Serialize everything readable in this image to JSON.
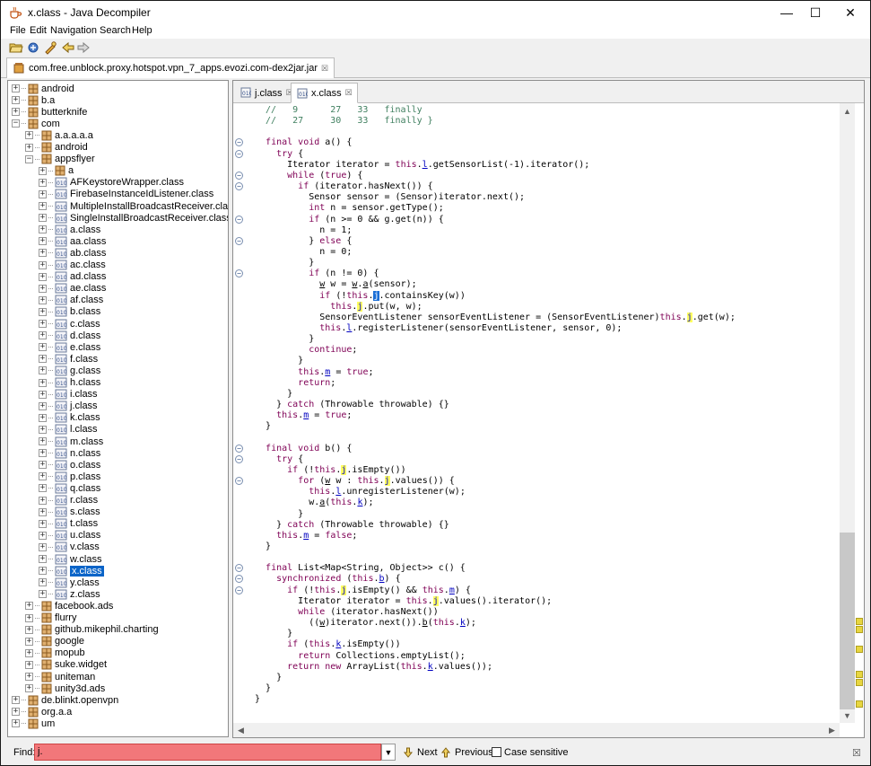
{
  "window": {
    "title": "x.class - Java Decompiler",
    "minimize": "—",
    "maximize": "☐",
    "close": "✕"
  },
  "menu": [
    "File",
    "Edit",
    "Navigation",
    "Search",
    "Help"
  ],
  "jar_tab": {
    "label": "com.free.unblock.proxy.hotspot.vpn_7_apps.evozi.com-dex2jar.jar",
    "close": "☒"
  },
  "tree": [
    {
      "label": "android",
      "level": 0,
      "type": "pkg",
      "exp": "+"
    },
    {
      "label": "b.a",
      "level": 0,
      "type": "pkg",
      "exp": "+"
    },
    {
      "label": "butterknife",
      "level": 0,
      "type": "pkg",
      "exp": "+"
    },
    {
      "label": "com",
      "level": 0,
      "type": "pkg",
      "exp": "−"
    },
    {
      "label": "a.a.a.a.a",
      "level": 1,
      "type": "pkg",
      "exp": "+"
    },
    {
      "label": "android",
      "level": 1,
      "type": "pkg",
      "exp": "+"
    },
    {
      "label": "appsflyer",
      "level": 1,
      "type": "pkg",
      "exp": "−"
    },
    {
      "label": "a",
      "level": 2,
      "type": "pkg",
      "exp": "+"
    },
    {
      "label": "AFKeystoreWrapper.class",
      "level": 2,
      "type": "cls",
      "exp": "+"
    },
    {
      "label": "FirebaseInstanceIdListener.class",
      "level": 2,
      "type": "cls",
      "exp": "+"
    },
    {
      "label": "MultipleInstallBroadcastReceiver.class",
      "level": 2,
      "type": "cls",
      "exp": "+"
    },
    {
      "label": "SingleInstallBroadcastReceiver.class",
      "level": 2,
      "type": "cls",
      "exp": "+"
    },
    {
      "label": "a.class",
      "level": 2,
      "type": "cls",
      "exp": "+"
    },
    {
      "label": "aa.class",
      "level": 2,
      "type": "cls",
      "exp": "+"
    },
    {
      "label": "ab.class",
      "level": 2,
      "type": "cls",
      "exp": "+"
    },
    {
      "label": "ac.class",
      "level": 2,
      "type": "cls",
      "exp": "+"
    },
    {
      "label": "ad.class",
      "level": 2,
      "type": "cls",
      "exp": "+"
    },
    {
      "label": "ae.class",
      "level": 2,
      "type": "cls",
      "exp": "+"
    },
    {
      "label": "af.class",
      "level": 2,
      "type": "cls",
      "exp": "+"
    },
    {
      "label": "b.class",
      "level": 2,
      "type": "cls",
      "exp": "+"
    },
    {
      "label": "c.class",
      "level": 2,
      "type": "cls",
      "exp": "+"
    },
    {
      "label": "d.class",
      "level": 2,
      "type": "cls",
      "exp": "+"
    },
    {
      "label": "e.class",
      "level": 2,
      "type": "cls",
      "exp": "+"
    },
    {
      "label": "f.class",
      "level": 2,
      "type": "cls",
      "exp": "+"
    },
    {
      "label": "g.class",
      "level": 2,
      "type": "cls",
      "exp": "+"
    },
    {
      "label": "h.class",
      "level": 2,
      "type": "cls",
      "exp": "+"
    },
    {
      "label": "i.class",
      "level": 2,
      "type": "cls",
      "exp": "+"
    },
    {
      "label": "j.class",
      "level": 2,
      "type": "cls",
      "exp": "+"
    },
    {
      "label": "k.class",
      "level": 2,
      "type": "cls",
      "exp": "+"
    },
    {
      "label": "l.class",
      "level": 2,
      "type": "cls",
      "exp": "+"
    },
    {
      "label": "m.class",
      "level": 2,
      "type": "cls",
      "exp": "+"
    },
    {
      "label": "n.class",
      "level": 2,
      "type": "cls",
      "exp": "+"
    },
    {
      "label": "o.class",
      "level": 2,
      "type": "cls",
      "exp": "+"
    },
    {
      "label": "p.class",
      "level": 2,
      "type": "cls",
      "exp": "+"
    },
    {
      "label": "q.class",
      "level": 2,
      "type": "cls",
      "exp": "+"
    },
    {
      "label": "r.class",
      "level": 2,
      "type": "cls",
      "exp": "+"
    },
    {
      "label": "s.class",
      "level": 2,
      "type": "cls",
      "exp": "+"
    },
    {
      "label": "t.class",
      "level": 2,
      "type": "cls",
      "exp": "+"
    },
    {
      "label": "u.class",
      "level": 2,
      "type": "cls",
      "exp": "+"
    },
    {
      "label": "v.class",
      "level": 2,
      "type": "cls",
      "exp": "+"
    },
    {
      "label": "w.class",
      "level": 2,
      "type": "cls",
      "exp": "+"
    },
    {
      "label": "x.class",
      "level": 2,
      "type": "cls",
      "exp": "+",
      "selected": true
    },
    {
      "label": "y.class",
      "level": 2,
      "type": "cls",
      "exp": "+"
    },
    {
      "label": "z.class",
      "level": 2,
      "type": "cls",
      "exp": "+"
    },
    {
      "label": "facebook.ads",
      "level": 1,
      "type": "pkg",
      "exp": "+"
    },
    {
      "label": "flurry",
      "level": 1,
      "type": "pkg",
      "exp": "+"
    },
    {
      "label": "github.mikephil.charting",
      "level": 1,
      "type": "pkg",
      "exp": "+"
    },
    {
      "label": "google",
      "level": 1,
      "type": "pkg",
      "exp": "+"
    },
    {
      "label": "mopub",
      "level": 1,
      "type": "pkg",
      "exp": "+"
    },
    {
      "label": "suke.widget",
      "level": 1,
      "type": "pkg",
      "exp": "+"
    },
    {
      "label": "uniteman",
      "level": 1,
      "type": "pkg",
      "exp": "+"
    },
    {
      "label": "unity3d.ads",
      "level": 1,
      "type": "pkg",
      "exp": "+"
    },
    {
      "label": "de.blinkt.openvpn",
      "level": 0,
      "type": "pkg",
      "exp": "+"
    },
    {
      "label": "org.a.a",
      "level": 0,
      "type": "pkg",
      "exp": "+"
    },
    {
      "label": "um",
      "level": 0,
      "type": "pkg",
      "exp": "+"
    }
  ],
  "editor_tabs": [
    {
      "label": "j.class",
      "close": "☒",
      "active": false
    },
    {
      "label": "x.class",
      "close": "☒",
      "active": true
    }
  ],
  "code_lines": [
    {
      "fold": "",
      "html": "<span class='cm'>  //   9      27   33   finally</span>"
    },
    {
      "fold": "",
      "html": "<span class='cm'>  //   27     30   33   finally }</span>"
    },
    {
      "fold": "",
      "html": ""
    },
    {
      "fold": "−",
      "html": "  <span class='kw'>final void</span> a() {"
    },
    {
      "fold": "−",
      "html": "    <span class='kw'>try</span> {"
    },
    {
      "fold": "",
      "html": "      Iterator iterator = <span class='kw'>this</span>.<span class='fld ul'>l</span>.getSensorList(-1).iterator();"
    },
    {
      "fold": "−",
      "html": "      <span class='kw'>while</span> (<span class='kw'>true</span>) {"
    },
    {
      "fold": "−",
      "html": "        <span class='kw'>if</span> (iterator.hasNext()) {"
    },
    {
      "fold": "",
      "html": "          Sensor sensor = (Sensor)iterator.next();"
    },
    {
      "fold": "",
      "html": "          <span class='kw'>int</span> n = sensor.getType();"
    },
    {
      "fold": "−",
      "html": "          <span class='kw'>if</span> (n &gt;= 0 &amp;&amp; <span class='ul'>g</span>.get(n)) {"
    },
    {
      "fold": "",
      "html": "            n = 1;"
    },
    {
      "fold": "−",
      "html": "          } <span class='kw'>else</span> {"
    },
    {
      "fold": "",
      "html": "            n = 0;"
    },
    {
      "fold": "",
      "html": "          }"
    },
    {
      "fold": "−",
      "html": "          <span class='kw'>if</span> (n != 0) {"
    },
    {
      "fold": "",
      "html": "            <span class='ul'>w</span> w = <span class='ul'>w</span>.<span class='ul'>a</span>(sensor);"
    },
    {
      "fold": "",
      "html": "            <span class='kw'>if</span> (!<span class='kw'>this</span>.<span class='hls'>j</span>.containsKey(w))"
    },
    {
      "fold": "",
      "html": "              <span class='kw'>this</span>.<span class='fld hl'>j</span>.put(w, w);"
    },
    {
      "fold": "",
      "html": "            SensorEventListener sensorEventListener = (SensorEventListener)<span class='kw'>this</span>.<span class='fld hl'>j</span>.get(w);"
    },
    {
      "fold": "",
      "html": "            <span class='kw'>this</span>.<span class='fld ul'>l</span>.registerListener(sensorEventListener, sensor, 0);"
    },
    {
      "fold": "",
      "html": "          }"
    },
    {
      "fold": "",
      "html": "          <span class='kw'>continue</span>;"
    },
    {
      "fold": "",
      "html": "        }"
    },
    {
      "fold": "",
      "html": "        <span class='kw'>this</span>.<span class='fld ul'>m</span> = <span class='kw'>true</span>;"
    },
    {
      "fold": "",
      "html": "        <span class='kw'>return</span>;"
    },
    {
      "fold": "",
      "html": "      }"
    },
    {
      "fold": "",
      "html": "    } <span class='kw'>catch</span> (Throwable throwable) {}"
    },
    {
      "fold": "",
      "html": "    <span class='kw'>this</span>.<span class='fld ul'>m</span> = <span class='kw'>true</span>;"
    },
    {
      "fold": "",
      "html": "  }"
    },
    {
      "fold": "",
      "html": ""
    },
    {
      "fold": "−",
      "html": "  <span class='kw'>final void</span> b() {"
    },
    {
      "fold": "−",
      "html": "    <span class='kw'>try</span> {"
    },
    {
      "fold": "",
      "html": "      <span class='kw'>if</span> (!<span class='kw'>this</span>.<span class='fld hl'>j</span>.isEmpty())"
    },
    {
      "fold": "−",
      "html": "        <span class='kw'>for</span> (<span class='ul'>w</span> w : <span class='kw'>this</span>.<span class='fld hl'>j</span>.values()) {"
    },
    {
      "fold": "",
      "html": "          <span class='kw'>this</span>.<span class='fld ul'>l</span>.unregisterListener(w);"
    },
    {
      "fold": "",
      "html": "          w.<span class='ul'>a</span>(<span class='kw'>this</span>.<span class='fld ul'>k</span>);"
    },
    {
      "fold": "",
      "html": "        }"
    },
    {
      "fold": "",
      "html": "    } <span class='kw'>catch</span> (Throwable throwable) {}"
    },
    {
      "fold": "",
      "html": "    <span class='kw'>this</span>.<span class='fld ul'>m</span> = <span class='kw'>false</span>;"
    },
    {
      "fold": "",
      "html": "  }"
    },
    {
      "fold": "",
      "html": ""
    },
    {
      "fold": "−",
      "html": "  <span class='kw'>final</span> List&lt;Map&lt;String, Object&gt;&gt; c() {"
    },
    {
      "fold": "−",
      "html": "    <span class='kw'>synchronized</span> (<span class='kw'>this</span>.<span class='fld ul'>b</span>) {"
    },
    {
      "fold": "−",
      "html": "      <span class='kw'>if</span> (!<span class='kw'>this</span>.<span class='fld hl'>j</span>.isEmpty() &amp;&amp; <span class='kw'>this</span>.<span class='fld ul'>m</span>) {"
    },
    {
      "fold": "",
      "html": "        Iterator iterator = <span class='kw'>this</span>.<span class='fld hl'>j</span>.values().iterator();"
    },
    {
      "fold": "",
      "html": "        <span class='kw'>while</span> (iterator.hasNext())"
    },
    {
      "fold": "",
      "html": "          ((<span class='ul'>w</span>)iterator.next()).<span class='ul'>b</span>(<span class='kw'>this</span>.<span class='fld ul'>k</span>);"
    },
    {
      "fold": "",
      "html": "      }"
    },
    {
      "fold": "",
      "html": "      <span class='kw'>if</span> (<span class='kw'>this</span>.<span class='fld ul'>k</span>.isEmpty())"
    },
    {
      "fold": "",
      "html": "        <span class='kw'>return</span> Collections.emptyList();"
    },
    {
      "fold": "",
      "html": "      <span class='kw'>return new</span> ArrayList(<span class='kw'>this</span>.<span class='fld ul'>k</span>.values());"
    },
    {
      "fold": "",
      "html": "    }"
    },
    {
      "fold": "",
      "html": "  }"
    },
    {
      "fold": "",
      "html": "}"
    }
  ],
  "find": {
    "label": "Find:",
    "value": "j.",
    "next": "Next",
    "previous": "Previous",
    "case_sensitive": "Case sensitive",
    "case_checked": false
  },
  "colors": {
    "find_error_bg": "#f2777a",
    "selection": "#0a64c8",
    "highlight": "#ffff60",
    "keyword": "#7f0055",
    "comment": "#3f7f5f"
  },
  "icons": [
    "duke-coffee-icon",
    "open-file-icon",
    "open-type-icon",
    "search-icon",
    "back-arrow-icon",
    "forward-arrow-icon",
    "jar-icon",
    "class-file-icon",
    "package-icon",
    "find-next-icon",
    "find-previous-icon",
    "close-find-icon"
  ]
}
